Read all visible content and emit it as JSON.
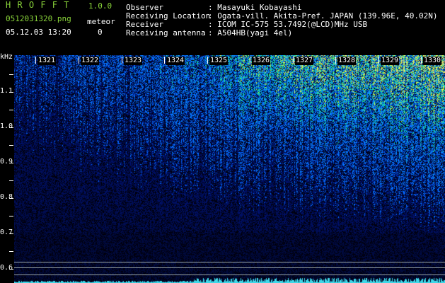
{
  "app": {
    "name": "H R O F F T",
    "version": "1.0.0",
    "file_name": "0512031320.png",
    "meteor_label": "meteor",
    "meteor_count": "0",
    "datetime": "05.12.03 13:20"
  },
  "info": {
    "rows": [
      {
        "label": "Observer",
        "value": ": Masayuki Kobayashi"
      },
      {
        "label": "Receiving Location",
        "value": ": Ogata-vill. Akita-Pref. JAPAN (139.96E, 40.02N)"
      },
      {
        "label": "Receiver",
        "value": ": ICOM IC-575 53.7492(@LCD)MHz USB"
      },
      {
        "label": "Receiving antenna",
        "value": ": A504HB(yagi 4el)"
      }
    ]
  },
  "axis": {
    "unit": "kHz",
    "ticks": [
      {
        "label": "1.1",
        "value": 1.1
      },
      {
        "label": "1.0",
        "value": 1.0
      },
      {
        "label": "0.9",
        "value": 0.9
      },
      {
        "label": "0.8",
        "value": 0.8
      },
      {
        "label": "0.7",
        "value": 0.7
      },
      {
        "label": "0.6",
        "value": 0.6
      }
    ]
  },
  "time_marks": [
    "1321",
    "1322",
    "1323",
    "1324",
    "1325",
    "1326",
    "1327",
    "1328",
    "1329",
    "1330"
  ],
  "colors": {
    "header_text_green": "#8ad53a",
    "header_text_white": "#ffffff",
    "background": "#000000",
    "signal_low": "#0a1a6e",
    "signal_mid": "#2a5cff",
    "signal_high": "#39e0c0",
    "baseline": "#3fd8e8"
  }
}
